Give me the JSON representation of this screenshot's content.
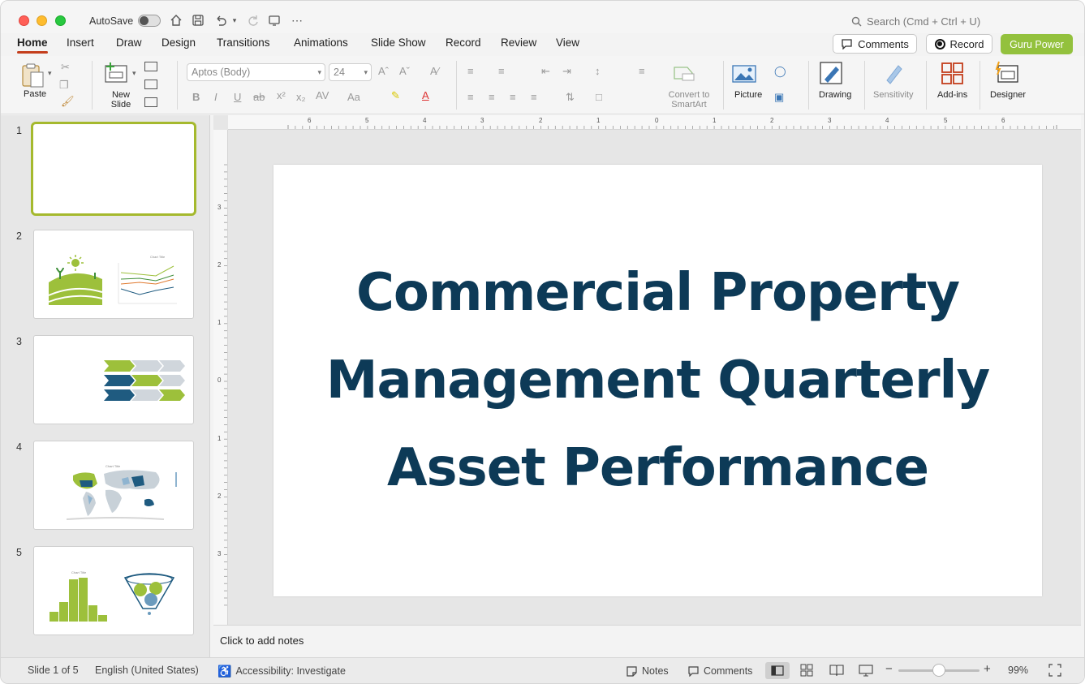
{
  "titlebar": {
    "autosave_label": "AutoSave",
    "autosave_on": false,
    "search_placeholder": "Search (Cmd + Ctrl + U)"
  },
  "tabs": [
    {
      "label": "Home",
      "active": true
    },
    {
      "label": "Insert"
    },
    {
      "label": "Draw"
    },
    {
      "label": "Design"
    },
    {
      "label": "Transitions"
    },
    {
      "label": "Animations"
    },
    {
      "label": "Slide Show"
    },
    {
      "label": "Record"
    },
    {
      "label": "Review"
    },
    {
      "label": "View"
    }
  ],
  "header_buttons": {
    "comments": "Comments",
    "record": "Record",
    "guru": "Guru Power"
  },
  "ribbon": {
    "paste": "Paste",
    "new_slide": "New Slide",
    "font_name": "Aptos (Body)",
    "font_size": "24",
    "convert_smartart": "Convert to SmartArt",
    "picture": "Picture",
    "drawing": "Drawing",
    "sensitivity": "Sensitivity",
    "addins": "Add-ins",
    "designer": "Designer"
  },
  "thumbnails": [
    {
      "number": "1",
      "selected": true
    },
    {
      "number": "2"
    },
    {
      "number": "3"
    },
    {
      "number": "4"
    },
    {
      "number": "5"
    }
  ],
  "ruler_h": [
    "6",
    "5",
    "4",
    "3",
    "2",
    "1",
    "0",
    "1",
    "2",
    "3",
    "4",
    "5",
    "6"
  ],
  "ruler_v": [
    "3",
    "2",
    "1",
    "0",
    "1",
    "2",
    "3"
  ],
  "slide": {
    "title_lines": [
      "Commercial Property",
      "Management Quarterly",
      "Asset Performance"
    ],
    "title_color": "#0d3a57"
  },
  "notes_placeholder": "Click to add notes",
  "statusbar": {
    "slide_count": "Slide 1 of 5",
    "language": "English (United States)",
    "accessibility": "Accessibility: Investigate",
    "notes": "Notes",
    "comments": "Comments",
    "zoom": "99%"
  },
  "colors": {
    "accent_green": "#93c13d",
    "tab_underline": "#c43e1c",
    "thumb_select": "#a5b92e"
  }
}
